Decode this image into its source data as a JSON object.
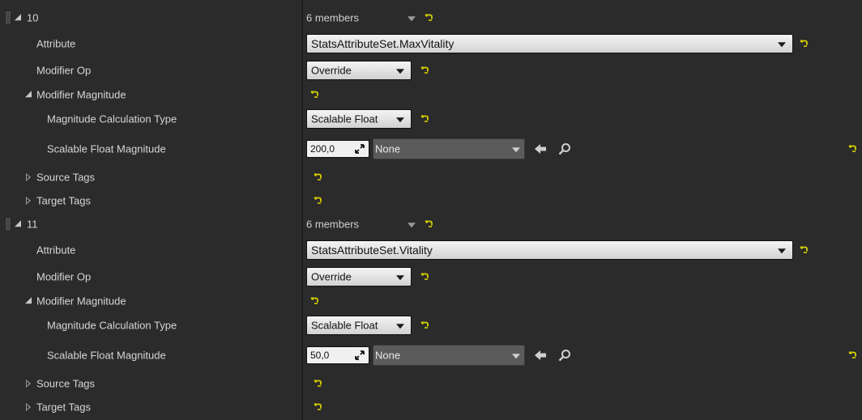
{
  "colors": {
    "reset_arrow": "#d8d200",
    "background": "#2b2b2b"
  },
  "icons": {
    "reset": "reset-to-default-arrow",
    "use_selected": "left-arrow-use-selected",
    "browse": "magnifier-browse"
  },
  "groups": [
    {
      "index_label": "10",
      "members_text": "6 members",
      "attribute_label": "Attribute",
      "attribute_value": "StatsAttributeSet.MaxVitality",
      "modifier_op_label": "Modifier Op",
      "modifier_op_value": "Override",
      "modifier_magnitude_label": "Modifier Magnitude",
      "calc_type_label": "Magnitude Calculation Type",
      "calc_type_value": "Scalable Float",
      "scalable_float_label": "Scalable Float Magnitude",
      "scalable_float_value": "200,0",
      "curve_table_value": "None",
      "source_tags_label": "Source Tags",
      "target_tags_label": "Target Tags"
    },
    {
      "index_label": "11",
      "members_text": "6 members",
      "attribute_label": "Attribute",
      "attribute_value": "StatsAttributeSet.Vitality",
      "modifier_op_label": "Modifier Op",
      "modifier_op_value": "Override",
      "modifier_magnitude_label": "Modifier Magnitude",
      "calc_type_label": "Magnitude Calculation Type",
      "calc_type_value": "Scalable Float",
      "scalable_float_label": "Scalable Float Magnitude",
      "scalable_float_value": "50,0",
      "curve_table_value": "None",
      "source_tags_label": "Source Tags",
      "target_tags_label": "Target Tags"
    }
  ]
}
